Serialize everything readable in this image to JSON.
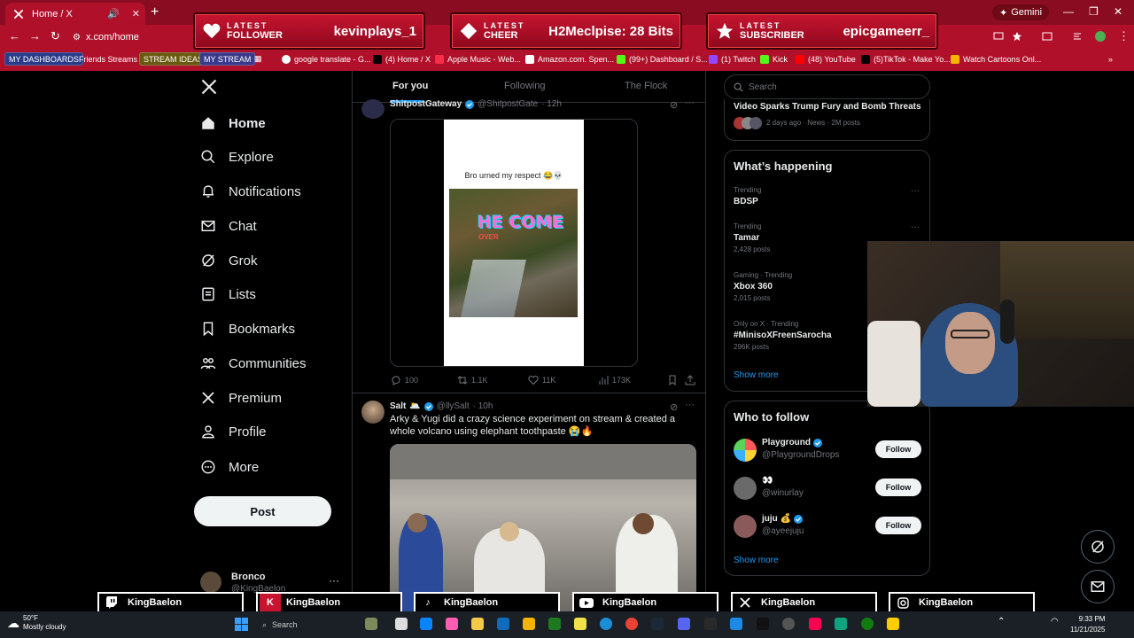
{
  "browser": {
    "tab_title": "Home / X",
    "address": "x.com/home",
    "gemini_label": "Gemini"
  },
  "banners": [
    {
      "kind_line1": "LATEST",
      "kind_line2": "FOLLOWER",
      "value": "kevinplays_1"
    },
    {
      "kind_line1": "LATEST",
      "kind_line2": "CHEER",
      "value": "H2Meclpise: 28 Bits"
    },
    {
      "kind_line1": "LATEST",
      "kind_line2": "SUBSCRIBER",
      "value": "epicgameerr_"
    }
  ],
  "bookmarks": [
    {
      "label": "MY DASHBOARDS"
    },
    {
      "label": "Friends Streams"
    },
    {
      "label": "STREAM IDEAS"
    },
    {
      "label": "MY STREAM"
    },
    {
      "label": "google translate - G..."
    },
    {
      "label": "(4) Home / X"
    },
    {
      "label": "Apple Music - Web..."
    },
    {
      "label": "Amazon.com. Spen..."
    },
    {
      "label": "(99+) Dashboard / S..."
    },
    {
      "label": "(1) Twitch"
    },
    {
      "label": "Kick"
    },
    {
      "label": "(48) YouTube"
    },
    {
      "label": "(5)TikTok - Make Yo..."
    },
    {
      "label": "Watch Cartoons Onl..."
    }
  ],
  "nav": [
    {
      "label": "Home",
      "icon": "home-icon"
    },
    {
      "label": "Explore",
      "icon": "search-icon"
    },
    {
      "label": "Notifications",
      "icon": "bell-icon"
    },
    {
      "label": "Chat",
      "icon": "mail-icon"
    },
    {
      "label": "Grok",
      "icon": "grok-icon"
    },
    {
      "label": "Lists",
      "icon": "list-icon"
    },
    {
      "label": "Bookmarks",
      "icon": "bookmark-icon"
    },
    {
      "label": "Communities",
      "icon": "people-icon"
    },
    {
      "label": "Premium",
      "icon": "x-icon"
    },
    {
      "label": "Profile",
      "icon": "person-icon"
    },
    {
      "label": "More",
      "icon": "more-icon"
    }
  ],
  "post_button": "Post",
  "account": {
    "name": "Bronco",
    "handle": "@KingBaelon",
    "menu": "···"
  },
  "feed_tabs": [
    "For you",
    "Following",
    "The Flock"
  ],
  "tweet1": {
    "name": "ShitpostGateway",
    "handle": "@ShitpostGate",
    "time": "· 12h",
    "caption": "Bro urned my respect 😂💀",
    "overlay_text": "HE COME",
    "overlay_sub": "OVER",
    "replies": "100",
    "reposts": "1.1K",
    "likes": "11K",
    "views": "173K"
  },
  "tweet2": {
    "name": "Salt",
    "emoji": "🌥️",
    "handle": "@llySalt",
    "time": "· 10h",
    "text": "Arky & Yugi did a crazy science experiment on stream & created a whole volcano using elephant toothpaste 😭🔥"
  },
  "search_placeholder": "Search",
  "top_news": {
    "title": "Video Sparks Trump Fury and Bomb Threats",
    "meta": "2 days ago · News · 2M posts"
  },
  "whats_happening": {
    "title": "What’s happening",
    "trends": [
      {
        "context": "Trending",
        "topic": "BDSP",
        "posts": ""
      },
      {
        "context": "Trending",
        "topic": "Tamar",
        "posts": "2,428 posts"
      },
      {
        "context": "Gaming · Trending",
        "topic": "Xbox 360",
        "posts": "2,015 posts"
      },
      {
        "context": "Only on X · Trending",
        "topic": "#MinisoXFreenSarocha",
        "posts": "296K posts"
      }
    ],
    "show_more": "Show more"
  },
  "who_to_follow": {
    "title": "Who to follow",
    "accounts": [
      {
        "name": "Playground",
        "handle": "@PlaygroundDrops",
        "verified": true,
        "button": "Follow"
      },
      {
        "name": "👀",
        "handle": "@winurlay",
        "verified": false,
        "button": "Follow"
      },
      {
        "name": "juju 💰",
        "handle": "@ayeejuju",
        "verified": true,
        "button": "Follow"
      }
    ],
    "show_more": "Show more"
  },
  "socials": [
    {
      "platform": "twitch-icon",
      "name": "KingBaelon"
    },
    {
      "platform": "kick-icon",
      "name": "KingBaelon"
    },
    {
      "platform": "tiktok-icon",
      "name": "KingBaelon"
    },
    {
      "platform": "youtube-icon",
      "name": "KingBaelon"
    },
    {
      "platform": "x-icon",
      "name": "KingBaelon"
    },
    {
      "platform": "instagram-icon",
      "name": "KingBaelon"
    }
  ],
  "taskbar": {
    "temp": "50°F",
    "weather": "Mostly cloudy",
    "search": "Search",
    "time": "9:33 PM",
    "date": "11/21/2025"
  },
  "colors": {
    "browser_red": "#b0102a",
    "x_blue": "#1d9bf0",
    "bg": "#000000"
  }
}
